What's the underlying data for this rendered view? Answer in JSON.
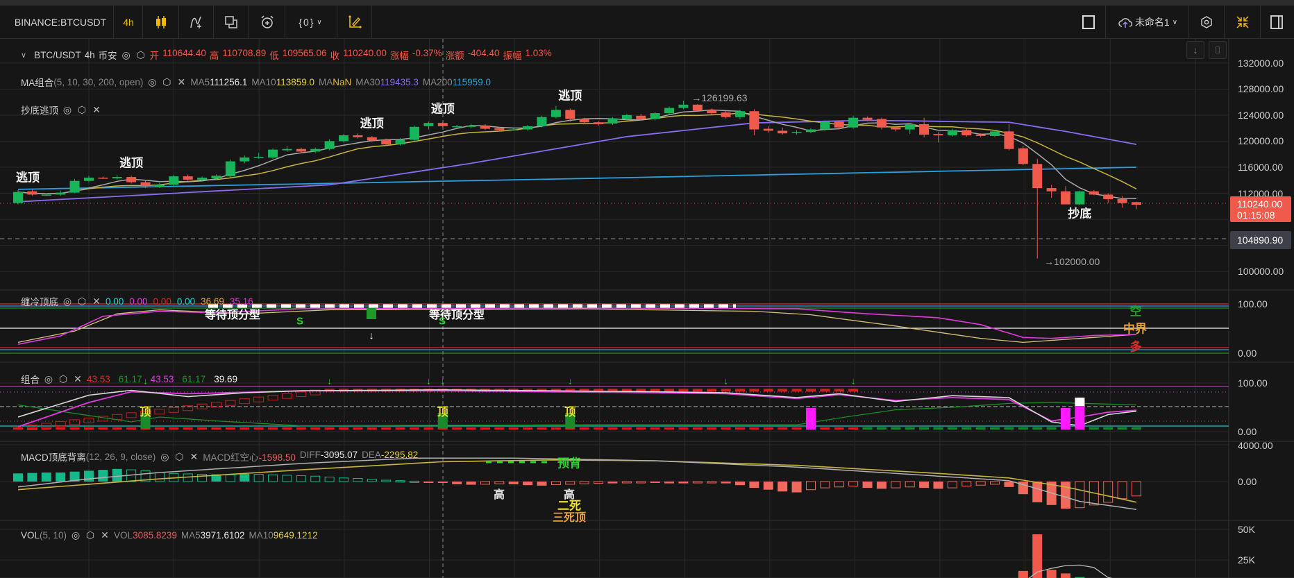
{
  "toolbar": {
    "symbol": "BINANCE:BTCUSDT",
    "interval": "4h",
    "indicator_template": "{0}",
    "layout_name": "未命名1"
  },
  "legend_main": {
    "pair": "BTC/USDT",
    "interval": "4h",
    "exchange": "币安",
    "ohlc": [
      {
        "k": "开",
        "v": "110644.40"
      },
      {
        "k": "高",
        "v": "110708.89"
      },
      {
        "k": "低",
        "v": "109565.06"
      },
      {
        "k": "收",
        "v": "110240.00"
      },
      {
        "k": "涨幅",
        "v": "-0.37%"
      },
      {
        "k": "涨额",
        "v": "-404.40"
      },
      {
        "k": "振幅",
        "v": "1.03%"
      }
    ]
  },
  "legend_ma": {
    "name": "MA组合",
    "params": "(5, 10, 30, 200, open)",
    "items": [
      {
        "k": "MA5",
        "v": "111256.1",
        "color": "#e8e8e8"
      },
      {
        "k": "MA10",
        "v": "113859.0",
        "color": "#e6d23a"
      },
      {
        "k": "MA",
        "v": "NaN",
        "color": "#e6b93a"
      },
      {
        "k": "MA30",
        "v": "119435.3",
        "color": "#8a6cf0"
      },
      {
        "k": "MA200",
        "v": "115959.0",
        "color": "#2a9fe0"
      }
    ]
  },
  "legend_signal": {
    "name": "抄底逃顶"
  },
  "legend_chanleng": {
    "name": "缠冷顶底",
    "values": [
      {
        "v": "0.00",
        "color": "#19d6d6"
      },
      {
        "v": "0.00",
        "color": "#e03ae0"
      },
      {
        "v": "0.00",
        "color": "#e02a2a"
      },
      {
        "v": "0.00",
        "color": "#19d6d6"
      },
      {
        "v": "36.69",
        "color": "#e6a33a"
      },
      {
        "v": "35.16",
        "color": "#d93ad9"
      }
    ],
    "wait_label": "等待顶分型",
    "s_label": "S",
    "kong": "空",
    "zhongjie": "中界",
    "duo": "多"
  },
  "legend_combo": {
    "name": "组合",
    "values": [
      {
        "v": "43.53",
        "color": "#e02a2a"
      },
      {
        "v": "61.17",
        "color": "#1f9a2a"
      },
      {
        "v": "43.53",
        "color": "#e03ae0"
      },
      {
        "v": "61.17",
        "color": "#1f9a2a"
      },
      {
        "v": "39.69",
        "color": "#f0f0f0"
      }
    ],
    "top_label": "顶"
  },
  "legend_macd": {
    "name": "MACD顶底背离",
    "params": "(12, 26, 9, close)",
    "items": [
      {
        "k": "MACD红空心",
        "v": "-1598.50",
        "color": "#ef5b5b"
      },
      {
        "k": "DIFF",
        "v": "-3095.07",
        "color": "#e8e8e8"
      },
      {
        "k": "DEA",
        "v": "-2295.82",
        "color": "#e6d23a"
      }
    ],
    "labels": {
      "high": "高",
      "pre_div": "预背",
      "two_death": "二死",
      "three_death_top": "三死顶"
    }
  },
  "legend_vol": {
    "name": "VOL",
    "params": "(5, 10)",
    "items": [
      {
        "k": "VOL",
        "v": "3085.8239",
        "color": "#ef5b5b"
      },
      {
        "k": "MA5",
        "v": "3971.6102",
        "color": "#e8e8e8"
      },
      {
        "k": "MA10",
        "v": "9649.1212",
        "color": "#e6d23a"
      }
    ]
  },
  "signals": {
    "escape_top": "逃顶",
    "buy_bottom": "抄底",
    "high_mark": "→126199.63",
    "low_mark": "→102000.00"
  },
  "axis": {
    "price": [
      "132000.00",
      "128000.00",
      "124000.00",
      "120000.00",
      "116000.00",
      "112000.00",
      "100000.00"
    ],
    "last_price": "110240.00",
    "countdown": "01:15:08",
    "crosshair_price": "104890.90",
    "chanleng": [
      "100.00",
      "0.00"
    ],
    "combo": [
      "100.00",
      "0.00"
    ],
    "macd": [
      "4000.00",
      "0.00"
    ],
    "vol": [
      "50K",
      "25K"
    ]
  },
  "colors": {
    "up": "#17b55a",
    "down": "#ef5a4c",
    "bg": "#161616",
    "grid": "#2a2a2a"
  },
  "chart_data": {
    "type": "candlestick",
    "candles": [
      [
        110500,
        112500,
        110300,
        112200
      ],
      [
        112300,
        112600,
        111600,
        111800
      ],
      [
        111800,
        112000,
        111600,
        111800
      ],
      [
        111800,
        112400,
        111600,
        112100
      ],
      [
        112100,
        114200,
        112000,
        113900
      ],
      [
        113900,
        114700,
        113700,
        114400
      ],
      [
        114400,
        114600,
        114200,
        114300
      ],
      [
        114300,
        114800,
        114100,
        114500
      ],
      [
        114500,
        114700,
        113500,
        113700
      ],
      [
        113700,
        113900,
        112800,
        113100
      ],
      [
        113000,
        113600,
        112800,
        113300
      ],
      [
        113300,
        114800,
        113000,
        114600
      ],
      [
        114600,
        114900,
        113900,
        114100
      ],
      [
        114100,
        114600,
        113900,
        114400
      ],
      [
        114300,
        114900,
        114100,
        114700
      ],
      [
        114600,
        117200,
        114400,
        116900
      ],
      [
        116900,
        117800,
        116600,
        117500
      ],
      [
        117500,
        118200,
        117300,
        117600
      ],
      [
        117500,
        118900,
        117300,
        118700
      ],
      [
        118600,
        119300,
        118400,
        118800
      ],
      [
        118800,
        119000,
        118200,
        118400
      ],
      [
        118400,
        119000,
        118200,
        118800
      ],
      [
        118800,
        120300,
        118600,
        120000
      ],
      [
        120000,
        121100,
        119800,
        120900
      ],
      [
        120900,
        121200,
        120400,
        120600
      ],
      [
        120600,
        120800,
        119900,
        120100
      ],
      [
        120200,
        120400,
        119300,
        119500
      ],
      [
        119500,
        120500,
        119300,
        120200
      ],
      [
        120200,
        122400,
        120000,
        122200
      ],
      [
        122300,
        123000,
        121800,
        122800
      ],
      [
        122800,
        123000,
        122100,
        122300
      ],
      [
        122300,
        122500,
        122100,
        122300
      ],
      [
        122200,
        122700,
        122000,
        122400
      ],
      [
        122400,
        122600,
        121700,
        121900
      ],
      [
        122000,
        122200,
        121500,
        121700
      ],
      [
        121800,
        122000,
        121600,
        121800
      ],
      [
        121800,
        122500,
        121600,
        122300
      ],
      [
        122300,
        123900,
        122100,
        123700
      ],
      [
        123700,
        125400,
        123500,
        124800
      ],
      [
        124800,
        125000,
        123000,
        123400
      ],
      [
        123400,
        123600,
        122700,
        122900
      ],
      [
        122900,
        123100,
        122400,
        122600
      ],
      [
        122700,
        123700,
        122500,
        123500
      ],
      [
        123400,
        124200,
        123200,
        124000
      ],
      [
        123900,
        124200,
        123200,
        123400
      ],
      [
        123400,
        124500,
        123200,
        124300
      ],
      [
        124300,
        125300,
        124100,
        125100
      ],
      [
        125100,
        126200,
        124900,
        125600
      ],
      [
        125600,
        125700,
        124500,
        124700
      ],
      [
        124800,
        125000,
        124100,
        124300
      ],
      [
        124400,
        124600,
        123500,
        123700
      ],
      [
        123700,
        124800,
        123400,
        124600
      ],
      [
        124600,
        124900,
        120900,
        121800
      ],
      [
        121900,
        122300,
        121300,
        121600
      ],
      [
        121600,
        122100,
        121000,
        121200
      ],
      [
        121300,
        121700,
        121000,
        121400
      ],
      [
        121400,
        122000,
        121200,
        121800
      ],
      [
        121800,
        123200,
        121600,
        123000
      ],
      [
        123000,
        123200,
        121800,
        122100
      ],
      [
        122100,
        123900,
        121900,
        123600
      ],
      [
        123600,
        123800,
        123100,
        123300
      ],
      [
        123400,
        123600,
        121800,
        122100
      ],
      [
        122100,
        122300,
        121500,
        121800
      ],
      [
        121800,
        122800,
        121100,
        122600
      ],
      [
        122600,
        123600,
        120600,
        121000
      ],
      [
        121100,
        121400,
        119800,
        120900
      ],
      [
        120900,
        121900,
        120700,
        121700
      ],
      [
        121700,
        121900,
        120700,
        120900
      ],
      [
        121000,
        121200,
        120600,
        120800
      ],
      [
        120800,
        121700,
        120600,
        121500
      ],
      [
        121500,
        122600,
        118600,
        118800
      ],
      [
        118900,
        119300,
        116300,
        116500
      ],
      [
        116500,
        117300,
        102000,
        112800
      ],
      [
        112800,
        113300,
        111300,
        112300
      ],
      [
        112300,
        113100,
        110300,
        110300
      ],
      [
        110300,
        112400,
        110200,
        112300
      ],
      [
        112300,
        112500,
        111700,
        111800
      ],
      [
        111800,
        112000,
        110500,
        111100
      ],
      [
        111100,
        111600,
        109800,
        110500
      ],
      [
        110644,
        110709,
        109565,
        110240
      ]
    ],
    "ma30": [
      [
        0,
        110700
      ],
      [
        22,
        113300
      ],
      [
        32,
        116600
      ],
      [
        43,
        120700
      ],
      [
        52,
        122800
      ],
      [
        60,
        123200
      ],
      [
        70,
        122900
      ],
      [
        74,
        121500
      ],
      [
        79,
        119500
      ]
    ],
    "ma200": [
      [
        0,
        112600
      ],
      [
        43,
        114400
      ],
      [
        79,
        116000
      ]
    ],
    "escape_top_at": [
      0,
      8,
      25,
      30,
      39
    ],
    "buy_bottom_at": [
      75
    ],
    "chanleng_magenta": [
      [
        0,
        18
      ],
      [
        3,
        35
      ],
      [
        6,
        75
      ],
      [
        10,
        85
      ],
      [
        14,
        82
      ],
      [
        20,
        90
      ],
      [
        40,
        92
      ],
      [
        55,
        90
      ],
      [
        60,
        80
      ],
      [
        65,
        72
      ],
      [
        68,
        58
      ],
      [
        71,
        32
      ],
      [
        73,
        30
      ],
      [
        76,
        36
      ],
      [
        79,
        38
      ]
    ],
    "chanleng_yellow": [
      [
        0,
        22
      ],
      [
        4,
        45
      ],
      [
        7,
        80
      ],
      [
        10,
        88
      ],
      [
        16,
        80
      ],
      [
        22,
        88
      ],
      [
        40,
        90
      ],
      [
        52,
        85
      ],
      [
        56,
        78
      ],
      [
        62,
        55
      ],
      [
        68,
        30
      ],
      [
        71,
        22
      ],
      [
        74,
        28
      ],
      [
        79,
        38
      ]
    ],
    "combo_white": [
      [
        0,
        30
      ],
      [
        5,
        75
      ],
      [
        8,
        85
      ],
      [
        12,
        72
      ],
      [
        16,
        80
      ],
      [
        20,
        84
      ],
      [
        30,
        86
      ],
      [
        45,
        82
      ],
      [
        50,
        80
      ],
      [
        55,
        70
      ],
      [
        58,
        78
      ],
      [
        62,
        62
      ],
      [
        66,
        74
      ],
      [
        70,
        70
      ],
      [
        73,
        20
      ],
      [
        75,
        12
      ],
      [
        77,
        35
      ],
      [
        79,
        42
      ]
    ],
    "combo_magenta": [
      [
        0,
        10
      ],
      [
        5,
        60
      ],
      [
        8,
        82
      ],
      [
        12,
        78
      ],
      [
        20,
        84
      ],
      [
        30,
        84
      ],
      [
        45,
        80
      ],
      [
        50,
        78
      ],
      [
        55,
        68
      ],
      [
        58,
        76
      ],
      [
        62,
        64
      ],
      [
        66,
        70
      ],
      [
        70,
        66
      ],
      [
        73,
        22
      ],
      [
        75,
        30
      ],
      [
        77,
        40
      ],
      [
        79,
        44
      ]
    ],
    "combo_green": [
      [
        0,
        55
      ],
      [
        8,
        20
      ],
      [
        10,
        30
      ],
      [
        14,
        22
      ],
      [
        20,
        12
      ],
      [
        40,
        14
      ],
      [
        55,
        14
      ],
      [
        58,
        28
      ],
      [
        62,
        45
      ],
      [
        66,
        50
      ],
      [
        70,
        58
      ],
      [
        73,
        60
      ],
      [
        79,
        55
      ]
    ],
    "combo_tops": [
      9,
      30,
      39
    ],
    "combo_magenta_bars": [
      56,
      74,
      75
    ],
    "macd_hist": [
      900,
      950,
      1000,
      1000,
      1100,
      1200,
      1300,
      1400,
      1300,
      1200,
      1000,
      900,
      850,
      800,
      800,
      750,
      850,
      800,
      750,
      700,
      650,
      600,
      500,
      400,
      350,
      250,
      150,
      100,
      50,
      -50,
      -150,
      -300,
      -350,
      -300,
      -250,
      -300,
      -400,
      -450,
      -350,
      -300,
      -250,
      -200,
      -200,
      -150,
      -100,
      -150,
      -200,
      -200,
      -150,
      -100,
      -200,
      -400,
      -700,
      -900,
      -1100,
      -1200,
      -900,
      -700,
      -600,
      -500,
      -700,
      -800,
      -700,
      -600,
      -700,
      -800,
      -700,
      -500,
      -400,
      -300,
      -600,
      -1400,
      -2300,
      -2600,
      -3000,
      -2900,
      -2600,
      -2300,
      -1900,
      -1600
    ],
    "macd_diff": [
      [
        0,
        -600
      ],
      [
        5,
        300
      ],
      [
        10,
        1000
      ],
      [
        20,
        2000
      ],
      [
        28,
        2600
      ],
      [
        35,
        2600
      ],
      [
        45,
        2300
      ],
      [
        55,
        1600
      ],
      [
        65,
        600
      ],
      [
        70,
        100
      ],
      [
        72,
        -800
      ],
      [
        75,
        -2200
      ],
      [
        79,
        -3095
      ]
    ],
    "macd_dea": [
      [
        0,
        -900
      ],
      [
        10,
        300
      ],
      [
        20,
        1300
      ],
      [
        30,
        2200
      ],
      [
        38,
        2400
      ],
      [
        45,
        2300
      ],
      [
        55,
        1800
      ],
      [
        65,
        900
      ],
      [
        70,
        400
      ],
      [
        74,
        -600
      ],
      [
        77,
        -1600
      ],
      [
        79,
        -2296
      ]
    ],
    "volume": [
      3000,
      2800,
      2500,
      2600,
      4000,
      3500,
      2000,
      2200,
      3000,
      2800,
      2200,
      3500,
      2600,
      2100,
      2400,
      5200,
      3800,
      2500,
      3600,
      2400,
      2300,
      2200,
      4200,
      3900,
      2600,
      2400,
      3000,
      2800,
      4500,
      3600,
      2800,
      1800,
      1900,
      2500,
      2300,
      1700,
      2600,
      4300,
      4700,
      4100,
      3000,
      2500,
      3000,
      2600,
      2200,
      2800,
      3800,
      4200,
      4000,
      3100,
      3300,
      3600,
      7800,
      3500,
      2700,
      2100,
      2500,
      4200,
      3600,
      4300,
      2400,
      3800,
      3000,
      3400,
      5200,
      3600,
      3000,
      3200,
      2200,
      2600,
      9000,
      16000,
      46000,
      17000,
      14000,
      11000,
      6000,
      5000,
      4500,
      3086
    ]
  }
}
